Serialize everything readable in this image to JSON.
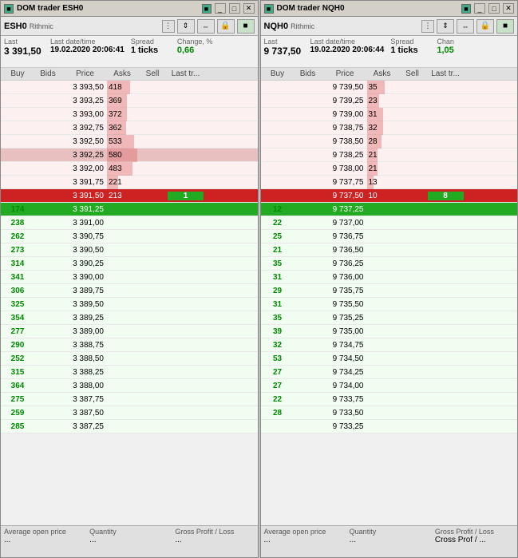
{
  "windows": [
    {
      "id": "esh0",
      "title": "DOM trader ESH0",
      "symbol": "ESH0",
      "exchange": "Rithmic",
      "last": "3 391,50",
      "last_label": "Last",
      "date_label": "Last date/time",
      "date": "19.02.2020 20:06:41",
      "spread_label": "Spread",
      "spread": "1 ticks",
      "change_label": "Change, %",
      "change": "0,66",
      "headers": [
        "Buy",
        "Bids",
        "Price",
        "Asks",
        "Sell",
        "Last tr..."
      ],
      "rows": [
        {
          "buy": "",
          "bids": "",
          "price": "3 393,50",
          "asks": "418",
          "sell": "",
          "last": "",
          "type": "ask",
          "ask_pct": 75
        },
        {
          "buy": "",
          "bids": "",
          "price": "3 393,25",
          "asks": "369",
          "sell": "",
          "last": "",
          "type": "ask",
          "ask_pct": 65
        },
        {
          "buy": "",
          "bids": "",
          "price": "3 393,00",
          "asks": "372",
          "sell": "",
          "last": "",
          "type": "ask",
          "ask_pct": 66
        },
        {
          "buy": "",
          "bids": "",
          "price": "3 392,75",
          "asks": "362",
          "sell": "",
          "last": "",
          "type": "ask",
          "ask_pct": 63
        },
        {
          "buy": "",
          "bids": "",
          "price": "3 392,50",
          "asks": "533",
          "sell": "",
          "last": "",
          "type": "ask",
          "ask_pct": 90
        },
        {
          "buy": "",
          "bids": "",
          "price": "3 392,25",
          "asks": "580",
          "sell": "",
          "last": "",
          "type": "ask-dark",
          "ask_pct": 100
        },
        {
          "buy": "",
          "bids": "",
          "price": "3 392,00",
          "asks": "483",
          "sell": "",
          "last": "",
          "type": "ask",
          "ask_pct": 83
        },
        {
          "buy": "",
          "bids": "",
          "price": "3 391,75",
          "asks": "221",
          "sell": "",
          "last": "",
          "type": "ask",
          "ask_pct": 38
        },
        {
          "buy": "",
          "bids": "",
          "price": "3 391,50",
          "asks": "213",
          "sell": "",
          "last": "1",
          "type": "current-ask"
        },
        {
          "buy": "174",
          "bids": "",
          "price": "3 391,25",
          "asks": "",
          "sell": "",
          "last": "",
          "type": "current-bid"
        },
        {
          "buy": "238",
          "bids": "",
          "price": "3 391,00",
          "asks": "",
          "sell": "",
          "last": "",
          "type": "bid"
        },
        {
          "buy": "262",
          "bids": "",
          "price": "3 390,75",
          "asks": "",
          "sell": "",
          "last": "",
          "type": "bid"
        },
        {
          "buy": "273",
          "bids": "",
          "price": "3 390,50",
          "asks": "",
          "sell": "",
          "last": "",
          "type": "bid"
        },
        {
          "buy": "314",
          "bids": "",
          "price": "3 390,25",
          "asks": "",
          "sell": "",
          "last": "",
          "type": "bid"
        },
        {
          "buy": "341",
          "bids": "",
          "price": "3 390,00",
          "asks": "",
          "sell": "",
          "last": "",
          "type": "bid"
        },
        {
          "buy": "306",
          "bids": "",
          "price": "3 389,75",
          "asks": "",
          "sell": "",
          "last": "",
          "type": "bid"
        },
        {
          "buy": "325",
          "bids": "",
          "price": "3 389,50",
          "asks": "",
          "sell": "",
          "last": "",
          "type": "bid"
        },
        {
          "buy": "354",
          "bids": "",
          "price": "3 389,25",
          "asks": "",
          "sell": "",
          "last": "",
          "type": "bid"
        },
        {
          "buy": "277",
          "bids": "",
          "price": "3 389,00",
          "asks": "",
          "sell": "",
          "last": "",
          "type": "bid"
        },
        {
          "buy": "290",
          "bids": "",
          "price": "3 388,75",
          "asks": "",
          "sell": "",
          "last": "",
          "type": "bid"
        },
        {
          "buy": "252",
          "bids": "",
          "price": "3 388,50",
          "asks": "",
          "sell": "",
          "last": "",
          "type": "bid"
        },
        {
          "buy": "315",
          "bids": "",
          "price": "3 388,25",
          "asks": "",
          "sell": "",
          "last": "",
          "type": "bid"
        },
        {
          "buy": "364",
          "bids": "",
          "price": "3 388,00",
          "asks": "",
          "sell": "",
          "last": "",
          "type": "bid"
        },
        {
          "buy": "275",
          "bids": "",
          "price": "3 387,75",
          "asks": "",
          "sell": "",
          "last": "",
          "type": "bid"
        },
        {
          "buy": "259",
          "bids": "",
          "price": "3 387,50",
          "asks": "",
          "sell": "",
          "last": "",
          "type": "bid"
        },
        {
          "buy": "285",
          "bids": "",
          "price": "3 387,25",
          "asks": "",
          "sell": "",
          "last": "",
          "type": "bid"
        }
      ],
      "footer": {
        "avg_label": "Average open price",
        "avg_value": "...",
        "qty_label": "Quantity",
        "qty_value": "...",
        "pnl_label": "Gross Profit / Loss",
        "pnl_value": "..."
      }
    },
    {
      "id": "nqh0",
      "title": "DOM trader NQH0",
      "symbol": "NQH0",
      "exchange": "Rithmic",
      "last": "9 737,50",
      "last_label": "Last",
      "date_label": "Last date/time",
      "date": "19.02.2020 20:06:44",
      "spread_label": "Spread",
      "spread": "1 ticks",
      "change_label": "Chan",
      "change": "1,05",
      "headers": [
        "Buy",
        "Bids",
        "Price",
        "Asks",
        "Sell",
        "Last tr..."
      ],
      "rows": [
        {
          "buy": "",
          "bids": "",
          "price": "9 739,50",
          "asks": "35",
          "sell": "",
          "last": "",
          "type": "ask",
          "ask_pct": 60
        },
        {
          "buy": "",
          "bids": "",
          "price": "9 739,25",
          "asks": "23",
          "sell": "",
          "last": "",
          "type": "ask",
          "ask_pct": 40
        },
        {
          "buy": "",
          "bids": "",
          "price": "9 739,00",
          "asks": "31",
          "sell": "",
          "last": "",
          "type": "ask",
          "ask_pct": 53
        },
        {
          "buy": "",
          "bids": "",
          "price": "9 738,75",
          "asks": "32",
          "sell": "",
          "last": "",
          "type": "ask",
          "ask_pct": 55
        },
        {
          "buy": "",
          "bids": "",
          "price": "9 738,50",
          "asks": "28",
          "sell": "",
          "last": "",
          "type": "ask",
          "ask_pct": 48
        },
        {
          "buy": "",
          "bids": "",
          "price": "9 738,25",
          "asks": "21",
          "sell": "",
          "last": "",
          "type": "ask",
          "ask_pct": 36
        },
        {
          "buy": "",
          "bids": "",
          "price": "9 738,00",
          "asks": "21",
          "sell": "",
          "last": "",
          "type": "ask",
          "ask_pct": 36
        },
        {
          "buy": "",
          "bids": "",
          "price": "9 737,75",
          "asks": "13",
          "sell": "",
          "last": "",
          "type": "ask",
          "ask_pct": 22
        },
        {
          "buy": "",
          "bids": "",
          "price": "9 737,50",
          "asks": "10",
          "sell": "",
          "last": "8",
          "type": "current-ask"
        },
        {
          "buy": "12",
          "bids": "",
          "price": "9 737,25",
          "asks": "",
          "sell": "",
          "last": "",
          "type": "current-bid"
        },
        {
          "buy": "22",
          "bids": "",
          "price": "9 737,00",
          "asks": "",
          "sell": "",
          "last": "",
          "type": "bid"
        },
        {
          "buy": "25",
          "bids": "",
          "price": "9 736,75",
          "asks": "",
          "sell": "",
          "last": "",
          "type": "bid"
        },
        {
          "buy": "21",
          "bids": "",
          "price": "9 736,50",
          "asks": "",
          "sell": "",
          "last": "",
          "type": "bid"
        },
        {
          "buy": "35",
          "bids": "",
          "price": "9 736,25",
          "asks": "",
          "sell": "",
          "last": "",
          "type": "bid"
        },
        {
          "buy": "31",
          "bids": "",
          "price": "9 736,00",
          "asks": "",
          "sell": "",
          "last": "",
          "type": "bid"
        },
        {
          "buy": "29",
          "bids": "",
          "price": "9 735,75",
          "asks": "",
          "sell": "",
          "last": "",
          "type": "bid"
        },
        {
          "buy": "31",
          "bids": "",
          "price": "9 735,50",
          "asks": "",
          "sell": "",
          "last": "",
          "type": "bid"
        },
        {
          "buy": "35",
          "bids": "",
          "price": "9 735,25",
          "asks": "",
          "sell": "",
          "last": "",
          "type": "bid"
        },
        {
          "buy": "39",
          "bids": "",
          "price": "9 735,00",
          "asks": "",
          "sell": "",
          "last": "",
          "type": "bid"
        },
        {
          "buy": "32",
          "bids": "",
          "price": "9 734,75",
          "asks": "",
          "sell": "",
          "last": "",
          "type": "bid"
        },
        {
          "buy": "53",
          "bids": "",
          "price": "9 734,50",
          "asks": "",
          "sell": "",
          "last": "",
          "type": "bid"
        },
        {
          "buy": "27",
          "bids": "",
          "price": "9 734,25",
          "asks": "",
          "sell": "",
          "last": "",
          "type": "bid"
        },
        {
          "buy": "27",
          "bids": "",
          "price": "9 734,00",
          "asks": "",
          "sell": "",
          "last": "",
          "type": "bid"
        },
        {
          "buy": "22",
          "bids": "",
          "price": "9 733,75",
          "asks": "",
          "sell": "",
          "last": "",
          "type": "bid"
        },
        {
          "buy": "28",
          "bids": "",
          "price": "9 733,50",
          "asks": "",
          "sell": "",
          "last": "",
          "type": "bid"
        },
        {
          "buy": "",
          "bids": "",
          "price": "9 733,25",
          "asks": "",
          "sell": "",
          "last": "",
          "type": "bid"
        }
      ],
      "footer": {
        "avg_label": "Average open price",
        "avg_value": "...",
        "qty_label": "Quantity",
        "qty_value": "...",
        "pnl_label": "Gross Profit / Loss",
        "pnl_value": "Cross Prof / ..."
      }
    }
  ]
}
